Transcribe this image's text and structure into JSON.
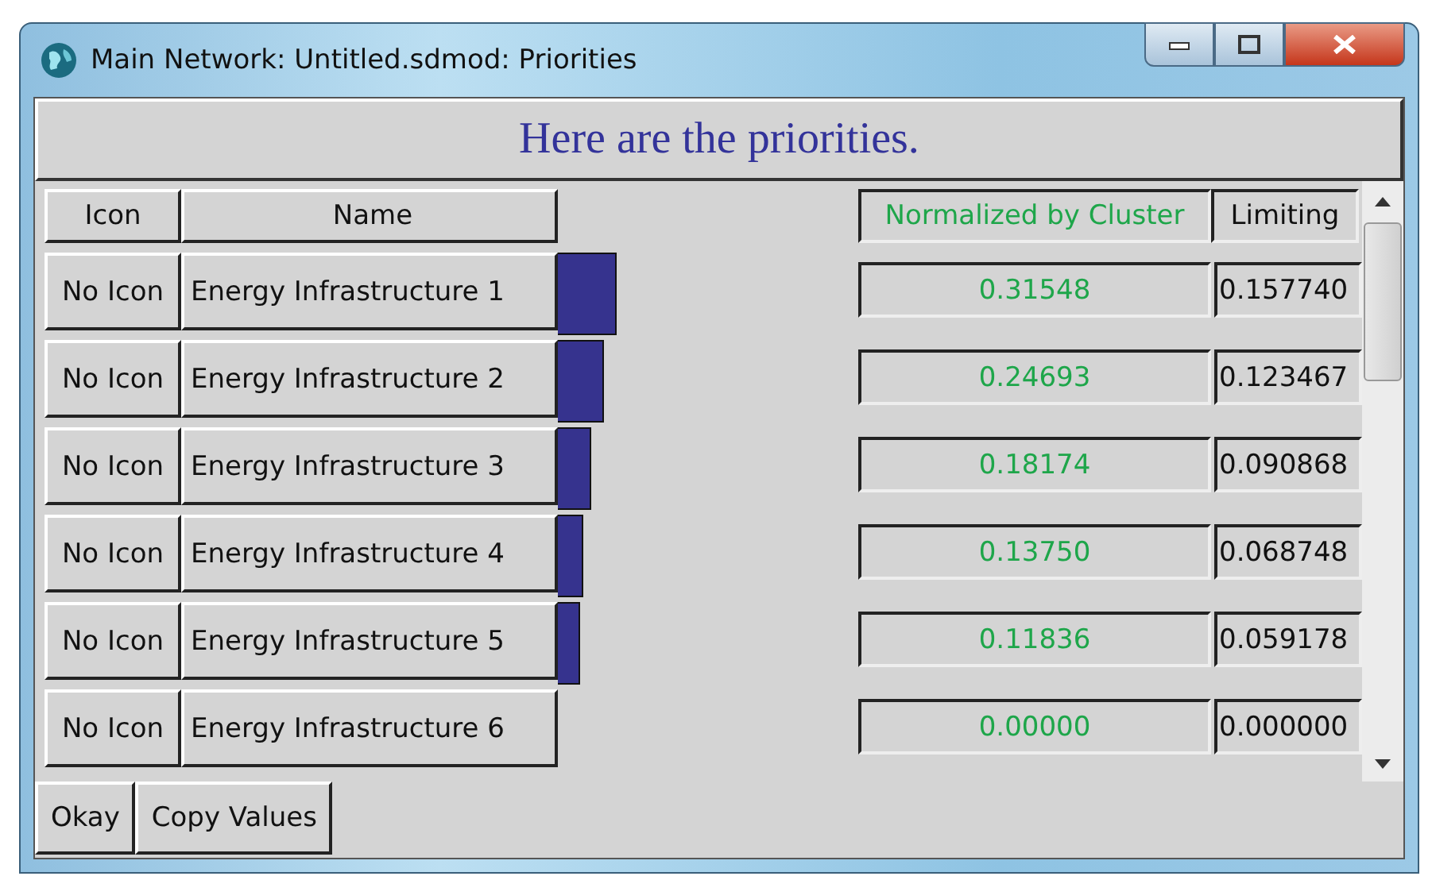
{
  "window": {
    "title": "Main Network: Untitled.sdmod: Priorities"
  },
  "heading": "Here are the priorities.",
  "columns": {
    "icon": "Icon",
    "name": "Name",
    "normalized": "Normalized by Cluster",
    "limiting": "Limiting"
  },
  "rows": [
    {
      "icon": "No Icon",
      "name": "Energy Infrastructure 1",
      "normalized": "0.31548",
      "limiting": "0.157740"
    },
    {
      "icon": "No Icon",
      "name": "Energy Infrastructure 2",
      "normalized": "0.24693",
      "limiting": "0.123467"
    },
    {
      "icon": "No Icon",
      "name": "Energy Infrastructure 3",
      "normalized": "0.18174",
      "limiting": "0.090868"
    },
    {
      "icon": "No Icon",
      "name": "Energy Infrastructure 4",
      "normalized": "0.13750",
      "limiting": "0.068748"
    },
    {
      "icon": "No Icon",
      "name": "Energy Infrastructure 5",
      "normalized": "0.11836",
      "limiting": "0.059178"
    },
    {
      "icon": "No Icon",
      "name": "Energy Infrastructure 6",
      "normalized": "0.00000",
      "limiting": "0.000000"
    }
  ],
  "buttons": [
    "Okay",
    "Copy Values"
  ]
}
